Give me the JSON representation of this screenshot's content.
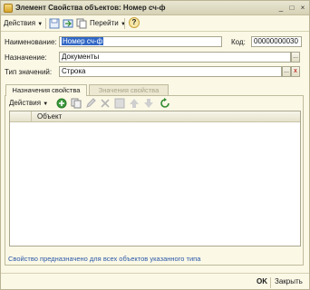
{
  "window": {
    "title": "Элемент Свойства объектов: Номер сч-ф",
    "controls": [
      "_",
      "□",
      "×"
    ]
  },
  "toolbar": {
    "actions_label": "Действия",
    "goto_label": "Перейти",
    "help_label": "?"
  },
  "form": {
    "name_label": "Наименование:",
    "name_value": "Номер сч-ф",
    "code_label": "Код:",
    "code_value": "00000000030",
    "purpose_label": "Назначение:",
    "purpose_value": "Документы",
    "type_label": "Тип значений:",
    "type_value": "Строка",
    "ellipsis": "...",
    "clear": "x"
  },
  "tabs": [
    {
      "label": "Назначения свойства",
      "active": true
    },
    {
      "label": "Значения свойства",
      "active": false
    }
  ],
  "panel": {
    "actions_label": "Действия",
    "table_columns": [
      "",
      "Объект"
    ],
    "rows": []
  },
  "note": "Свойство предназначено для всех объектов указанного типа",
  "footer": {
    "ok_label": "OK",
    "close_label": "Закрыть"
  },
  "colors": {
    "window_bg": "#fbf8e6",
    "selection": "#3167c5",
    "note_text": "#2b58a8",
    "add_icon": "#3a9a3a"
  }
}
